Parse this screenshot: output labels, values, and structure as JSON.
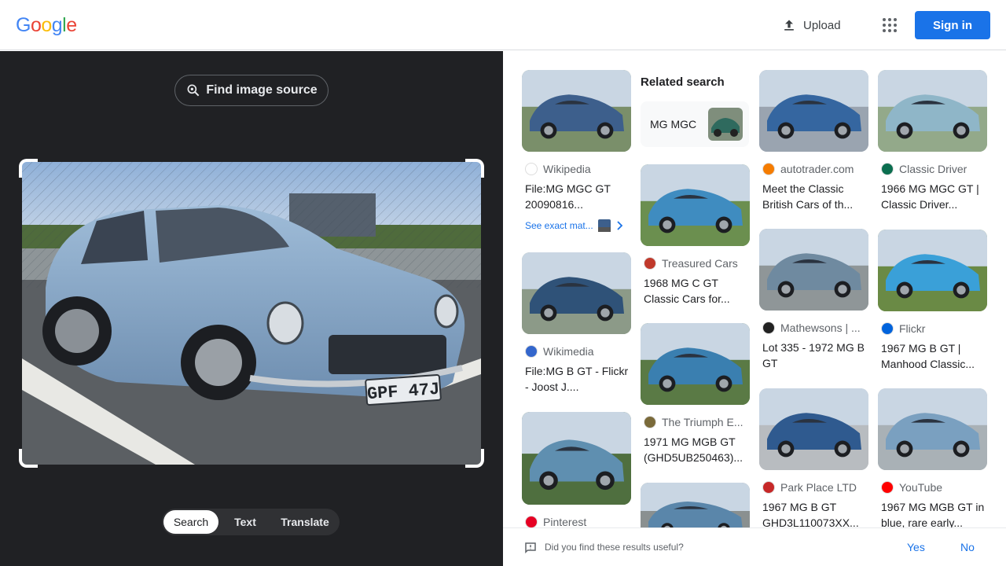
{
  "header": {
    "logo_letters": [
      {
        "ch": "G",
        "color": "#4285f4"
      },
      {
        "ch": "o",
        "color": "#ea4335"
      },
      {
        "ch": "o",
        "color": "#fbbc05"
      },
      {
        "ch": "g",
        "color": "#4285f4"
      },
      {
        "ch": "l",
        "color": "#34a853"
      },
      {
        "ch": "e",
        "color": "#ea4335"
      }
    ],
    "upload_label": "Upload",
    "apps_icon": "apps-grid-icon",
    "signin_label": "Sign in"
  },
  "left": {
    "find_source_label": "Find image source",
    "plate_text": "GPF 47J",
    "modes": [
      "Search",
      "Text",
      "Translate"
    ],
    "active_mode": "Search"
  },
  "related": {
    "heading": "Related search",
    "chip_label": "MG MGC"
  },
  "results": [
    {
      "source": "Wikipedia",
      "title": "File:MG MGC GT 20090816...",
      "icon": "wikipedia-icon",
      "icon_color": "#ffffff",
      "car_color": "#3d5f8c",
      "bg": "#7a8f6a"
    },
    {
      "source": "Wikimedia",
      "title": "File:MG B GT - Flickr - Joost J....",
      "icon": "wikimedia-icon",
      "icon_color": "#3366cc",
      "car_color": "#2f5278",
      "bg": "#8c9a88"
    },
    {
      "source": "Pinterest",
      "title": "",
      "icon": "pinterest-icon",
      "icon_color": "#e60023",
      "car_color": "#5f8fb0",
      "bg": "#4f6f3f"
    },
    {
      "source": "Treasured Cars",
      "title": "1968 MG C GT Classic Cars for...",
      "icon": "treasured-cars-icon",
      "icon_color": "#c0392b",
      "car_color": "#3f8cc0",
      "bg": "#6b8f4f"
    },
    {
      "source": "The Triumph E...",
      "title": "1971 MG MGB GT (GHD5UB250463)...",
      "icon": "triumph-icon",
      "icon_color": "#7a6a3a",
      "car_color": "#3a7fb0",
      "bg": "#5a7a45"
    },
    {
      "source": "",
      "title": "",
      "icon": "",
      "icon_color": "#888888",
      "car_color": "#5a86aa",
      "bg": "#8a9090"
    },
    {
      "source": "autotrader.com",
      "title": "Meet the Classic British Cars of th...",
      "icon": "autotrader-icon",
      "icon_color": "#f57c00",
      "car_color": "#3566a0",
      "bg": "#9aa4b0"
    },
    {
      "source": "Mathewsons | ...",
      "title": "Lot 335 - 1972 MG B GT",
      "icon": "mathewsons-icon",
      "icon_color": "#222222",
      "car_color": "#6f8aa0",
      "bg": "#8f9698"
    },
    {
      "source": "Park Place LTD",
      "title": "1967 MG B GT GHD3L110073XX...",
      "icon": "park-place-icon",
      "icon_color": "#c62828",
      "car_color": "#2f5a8f",
      "bg": "#b8bcc0"
    },
    {
      "source": "Classic Driver",
      "title": "1966 MG MGC GT | Classic Driver...",
      "icon": "classic-driver-icon",
      "icon_color": "#0b6e4f",
      "car_color": "#8fb6c8",
      "bg": "#93a98a"
    },
    {
      "source": "Flickr",
      "title": "1967 MG B GT | Manhood Classic...",
      "icon": "flickr-icon",
      "icon_color": "#0063dc",
      "car_color": "#3aa0d8",
      "bg": "#6a8a45"
    },
    {
      "source": "YouTube",
      "title": "1967 MG MGB GT in blue, rare early...",
      "icon": "youtube-icon",
      "icon_color": "#ff0000",
      "car_color": "#7aa0c0",
      "bg": "#a9b1b6"
    }
  ],
  "exact_match_label": "See exact mat...",
  "feedback": {
    "question": "Did you find these results useful?",
    "yes": "Yes",
    "no": "No"
  }
}
